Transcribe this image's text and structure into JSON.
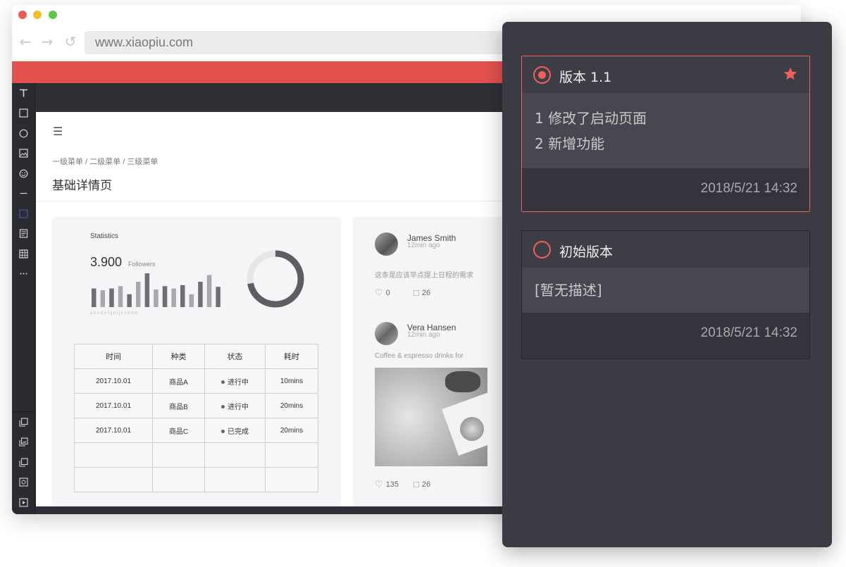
{
  "browser": {
    "url": "www.xiaopiu.com"
  },
  "page": {
    "breadcrumb": "一级菜单 / 二级菜单 / 三级菜单",
    "title": "基础详情页"
  },
  "stats": {
    "label": "Statistics",
    "number": "3.900",
    "sub": "Followers",
    "bar_letters": "a b c d e f g h i j k l m n o",
    "bar_values": [
      0.55,
      0.5,
      0.55,
      0.62,
      0.38,
      0.75,
      1.0,
      0.52,
      0.62,
      0.55,
      0.65,
      0.38,
      0.75,
      0.95,
      0.6
    ],
    "donut_fraction": 0.72
  },
  "table": {
    "headers": [
      "时间",
      "种类",
      "状态",
      "耗时"
    ],
    "rows": [
      [
        "2017.10.01",
        "商品A",
        "进行中",
        "10mins"
      ],
      [
        "2017.10.01",
        "商品B",
        "进行中",
        "20mins"
      ],
      [
        "2017.10.01",
        "商品C",
        "已完成",
        "20mins"
      ],
      [
        "",
        "",
        "",
        ""
      ],
      [
        "",
        "",
        "",
        ""
      ]
    ]
  },
  "feed": [
    {
      "name": "James Smith",
      "time": "12min ago",
      "text": "这条是应该早点提上日程的需求",
      "likes": "0",
      "comments": "26"
    },
    {
      "name": "Vera Hansen",
      "time": "12min ago",
      "text": "Coffee & espresso drinks for",
      "likes": "135",
      "comments": "26"
    }
  ],
  "versions": [
    {
      "title": "版本 1.1",
      "desc": [
        "1 修改了启动页面",
        "2 新增功能"
      ],
      "date": "2018/5/21 14:32",
      "selected": true,
      "starred": true
    },
    {
      "title": "初始版本",
      "desc": [
        "[暂无描述]"
      ],
      "date": "2018/5/21 14:32",
      "selected": false,
      "starred": false
    }
  ],
  "colors": {
    "accent": "#f0605a",
    "toolbar_red": "#e3514f",
    "panel_bg": "#3a3b43"
  },
  "icons": {
    "tools": [
      "text-icon",
      "rectangle-icon",
      "circle-icon",
      "image-icon",
      "emoji-icon",
      "line-icon",
      "frame-icon",
      "document-icon",
      "table-icon",
      "more-icon"
    ],
    "bottom_tools": [
      "copy-icon",
      "gallery-icon",
      "duplicate-icon",
      "screenshot-icon",
      "play-icon"
    ]
  }
}
